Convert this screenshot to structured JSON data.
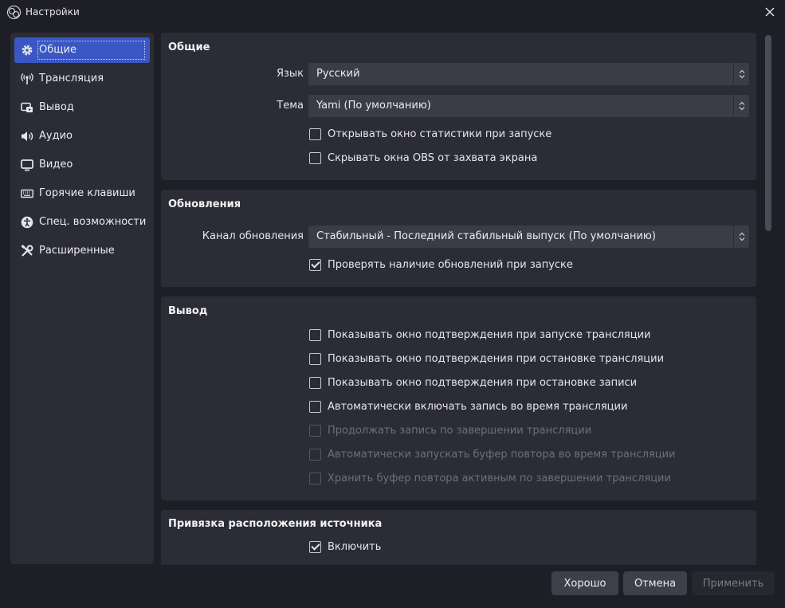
{
  "window": {
    "title": "Настройки"
  },
  "sidebar": {
    "items": [
      {
        "label": "Общие",
        "icon": "gear-icon",
        "active": true
      },
      {
        "label": "Трансляция",
        "icon": "broadcast-icon"
      },
      {
        "label": "Вывод",
        "icon": "output-icon"
      },
      {
        "label": "Аудио",
        "icon": "speaker-icon"
      },
      {
        "label": "Видео",
        "icon": "monitor-icon"
      },
      {
        "label": "Горячие клавиши",
        "icon": "keyboard-icon"
      },
      {
        "label": "Спец. возможности",
        "icon": "accessibility-icon"
      },
      {
        "label": "Расширенные",
        "icon": "tools-icon"
      }
    ]
  },
  "general": {
    "title": "Общие",
    "language_label": "Язык",
    "language_value": "Русский",
    "theme_label": "Тема",
    "theme_value": "Yami (По умолчанию)",
    "checkboxes": [
      {
        "label": "Открывать окно статистики при запуске",
        "checked": false
      },
      {
        "label": "Скрывать окна OBS от захвата экрана",
        "checked": false
      }
    ]
  },
  "updates": {
    "title": "Обновления",
    "channel_label": "Канал обновления",
    "channel_value": "Стабильный - Последний стабильный выпуск (По умолчанию)",
    "checkboxes": [
      {
        "label": "Проверять наличие обновлений при запуске",
        "checked": true
      }
    ]
  },
  "output": {
    "title": "Вывод",
    "checkboxes": [
      {
        "label": "Показывать окно подтверждения при запуске трансляции",
        "checked": false,
        "disabled": false
      },
      {
        "label": "Показывать окно подтверждения при остановке трансляции",
        "checked": false,
        "disabled": false
      },
      {
        "label": "Показывать окно подтверждения при остановке записи",
        "checked": false,
        "disabled": false
      },
      {
        "label": "Автоматически включать запись во время трансляции",
        "checked": false,
        "disabled": false
      },
      {
        "label": "Продолжать запись по завершении трансляции",
        "checked": false,
        "disabled": true
      },
      {
        "label": "Автоматически запускать буфер повтора во время трансляции",
        "checked": false,
        "disabled": true
      },
      {
        "label": "Хранить буфер повтора активным по завершении трансляции",
        "checked": false,
        "disabled": true
      }
    ]
  },
  "snapping": {
    "title": "Привязка расположения источника",
    "checkboxes": [
      {
        "label": "Включить",
        "checked": true
      }
    ]
  },
  "buttons": {
    "ok": "Хорошо",
    "cancel": "Отмена",
    "apply": "Применить"
  },
  "colors": {
    "accent": "#3a57c4",
    "background": "#1e1f26",
    "panel": "#2b2c36"
  }
}
